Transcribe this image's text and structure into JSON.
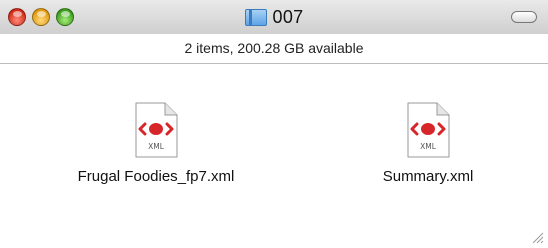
{
  "window": {
    "title": "007",
    "status": "2 items, 200.28 GB available",
    "title_icon": "folder-icon"
  },
  "files": [
    {
      "name": "Frugal Foodies_fp7.xml",
      "icon": "xml-file-icon",
      "type_label": "XML"
    },
    {
      "name": "Summary.xml",
      "icon": "xml-file-icon",
      "type_label": "XML"
    }
  ],
  "colors": {
    "xml_accent": "#d7262a",
    "close": "#d22a18",
    "minimize": "#e09a10",
    "zoom": "#3c9d1d"
  }
}
